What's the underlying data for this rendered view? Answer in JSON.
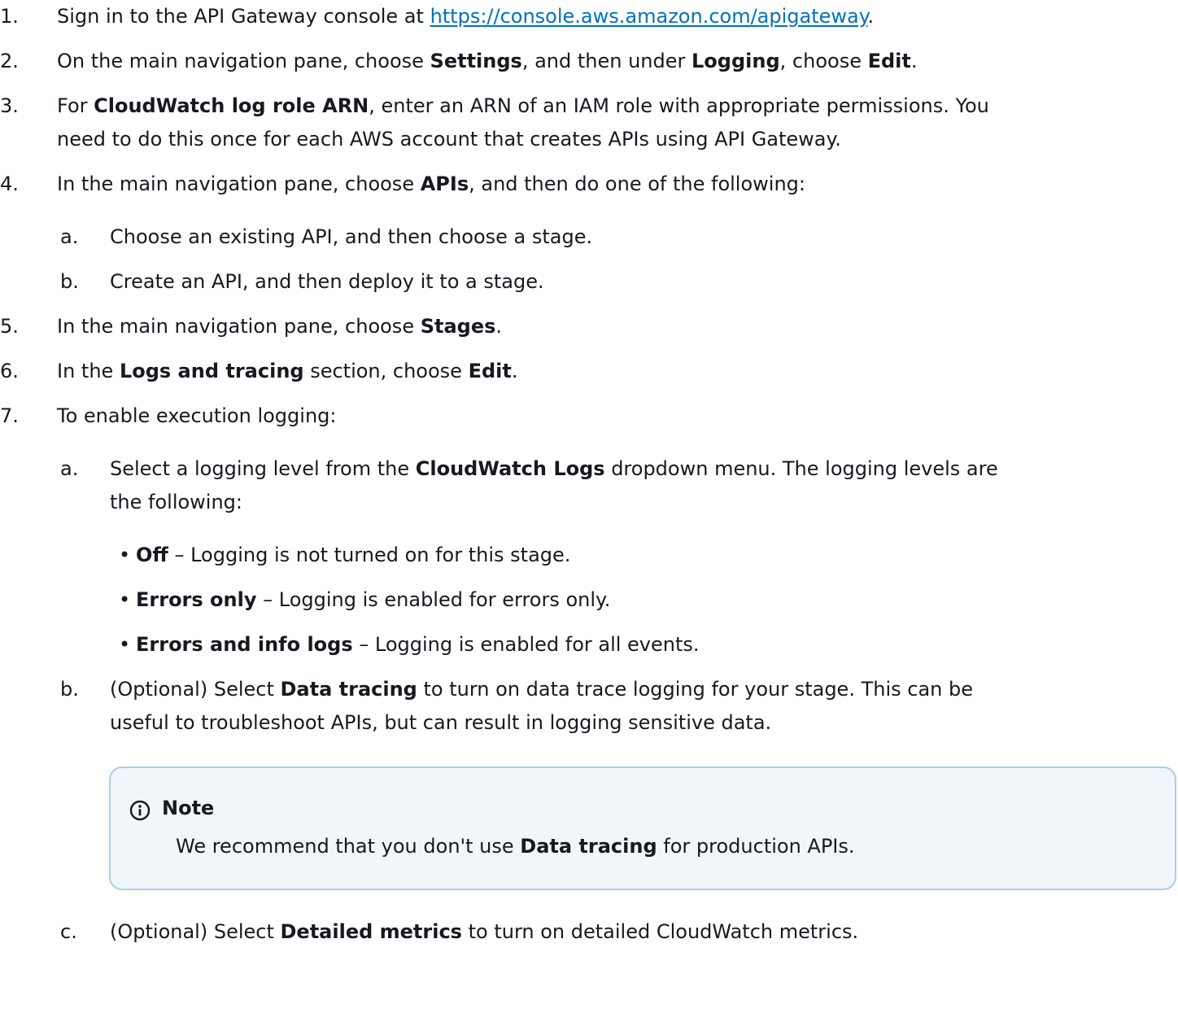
{
  "steps": {
    "s1": {
      "num": "1.",
      "pre": "Sign in to the API Gateway console at ",
      "link": "https://console.aws.amazon.com/apigateway",
      "post": "."
    },
    "s2": {
      "num": "2.",
      "t1": "On the main navigation pane, choose ",
      "b1": "Settings",
      "t2": ", and then under ",
      "b2": "Logging",
      "t3": ", choose ",
      "b3": "Edit",
      "t4": "."
    },
    "s3": {
      "num": "3.",
      "t1": "For ",
      "b1": "CloudWatch log role ARN",
      "t2": ", enter an ARN of an IAM role with appropriate permissions. You",
      "line2": "need to do this once for each AWS account that creates APIs using API Gateway."
    },
    "s4": {
      "num": "4.",
      "t1": "In the main navigation pane, choose ",
      "b1": "APIs",
      "t2": ", and then do one of the following:",
      "a": {
        "num": "a.",
        "text": "Choose an existing API, and then choose a stage."
      },
      "b": {
        "num": "b.",
        "text": "Create an API, and then deploy it to a stage."
      }
    },
    "s5": {
      "num": "5.",
      "t1": "In the main navigation pane, choose ",
      "b1": "Stages",
      "t2": "."
    },
    "s6": {
      "num": "6.",
      "t1": "In the ",
      "b1": "Logs and tracing",
      "t2": " section, choose ",
      "b2": "Edit",
      "t3": "."
    },
    "s7": {
      "num": "7.",
      "text": "To enable execution logging:",
      "a": {
        "num": "a.",
        "t1": "Select a logging level from the ",
        "b1": "CloudWatch Logs",
        "t2": " dropdown menu. The logging levels are",
        "line2": "the following:",
        "bullets": [
          {
            "term": "Off",
            "desc": " – Logging is not turned on for this stage."
          },
          {
            "term": "Errors only",
            "desc": " – Logging is enabled for errors only."
          },
          {
            "term": "Errors and info logs",
            "desc": " – Logging is enabled for all events."
          }
        ]
      },
      "b": {
        "num": "b.",
        "t1": "(Optional) Select ",
        "b1": "Data tracing",
        "t2": " to turn on data trace logging for your stage. This can be",
        "line2": "useful to troubleshoot APIs, but can result in logging sensitive data."
      },
      "c": {
        "num": "c.",
        "t1": "(Optional) Select ",
        "b1": "Detailed metrics",
        "t2": " to turn on detailed CloudWatch metrics."
      }
    }
  },
  "note": {
    "title": "Note",
    "t1": "We recommend that you don't use ",
    "b1": "Data tracing",
    "t2": " for production APIs",
    "t3": "."
  },
  "icons": {
    "note": "info-circle-icon"
  },
  "colors": {
    "text": "#16191f",
    "link": "#0073bb",
    "note_border": "#a9cfe6",
    "note_bg": "#f1f6fb"
  },
  "bullet_char": "•"
}
